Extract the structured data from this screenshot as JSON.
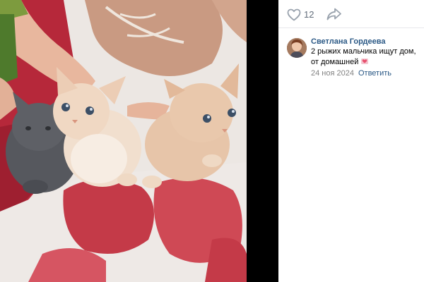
{
  "actions": {
    "like_count": "12",
    "like_icon": "heart-outline-icon",
    "share_icon": "share-arrow-icon"
  },
  "comment": {
    "author": "Светлана Гордеева",
    "text": "2 рыжих мальчика ищут дом, от домашней",
    "emoji": "heart-gift-emoji",
    "date": "24 ноя 2024",
    "reply_label": "Ответить"
  },
  "colors": {
    "link": "#2a5885",
    "meta": "#828282",
    "icon": "#99a2ad"
  }
}
